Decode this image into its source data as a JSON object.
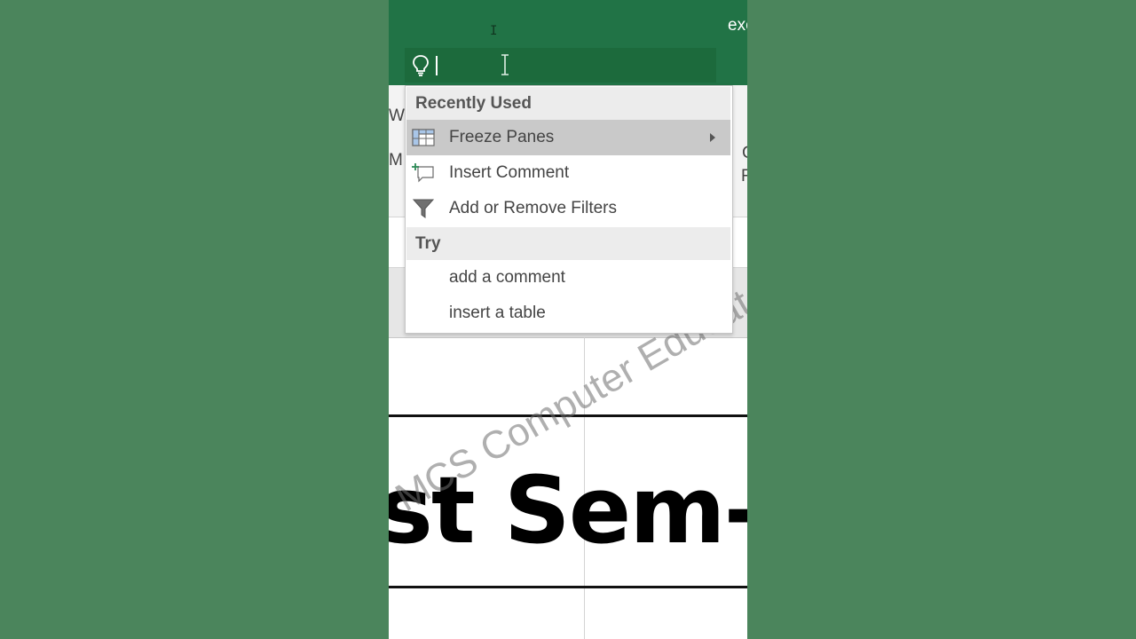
{
  "window": {
    "title": "exc"
  },
  "ribbon": {
    "left_letters": [
      "W",
      "M"
    ],
    "right_letters": [
      "C",
      "F"
    ]
  },
  "tell_me": {
    "value": "",
    "icon": "lightbulb-icon"
  },
  "menu": {
    "section_recent": "Recently Used",
    "recent_items": [
      {
        "label": "Freeze Panes",
        "icon": "freeze-panes-icon",
        "has_submenu": true
      },
      {
        "label": "Insert Comment",
        "icon": "new-comment-icon"
      },
      {
        "label": "Add or Remove Filters",
        "icon": "filter-icon"
      }
    ],
    "section_try": "Try",
    "try_items": [
      {
        "label": "add a comment"
      },
      {
        "label": "insert a table"
      }
    ]
  },
  "sheet": {
    "cell_text": "st Sem-"
  },
  "watermark": {
    "text": "MCS Computer Educat"
  },
  "colors": {
    "excel_green": "#217346",
    "menu_hover": "#c9c9c9",
    "background": "#4a845b"
  }
}
